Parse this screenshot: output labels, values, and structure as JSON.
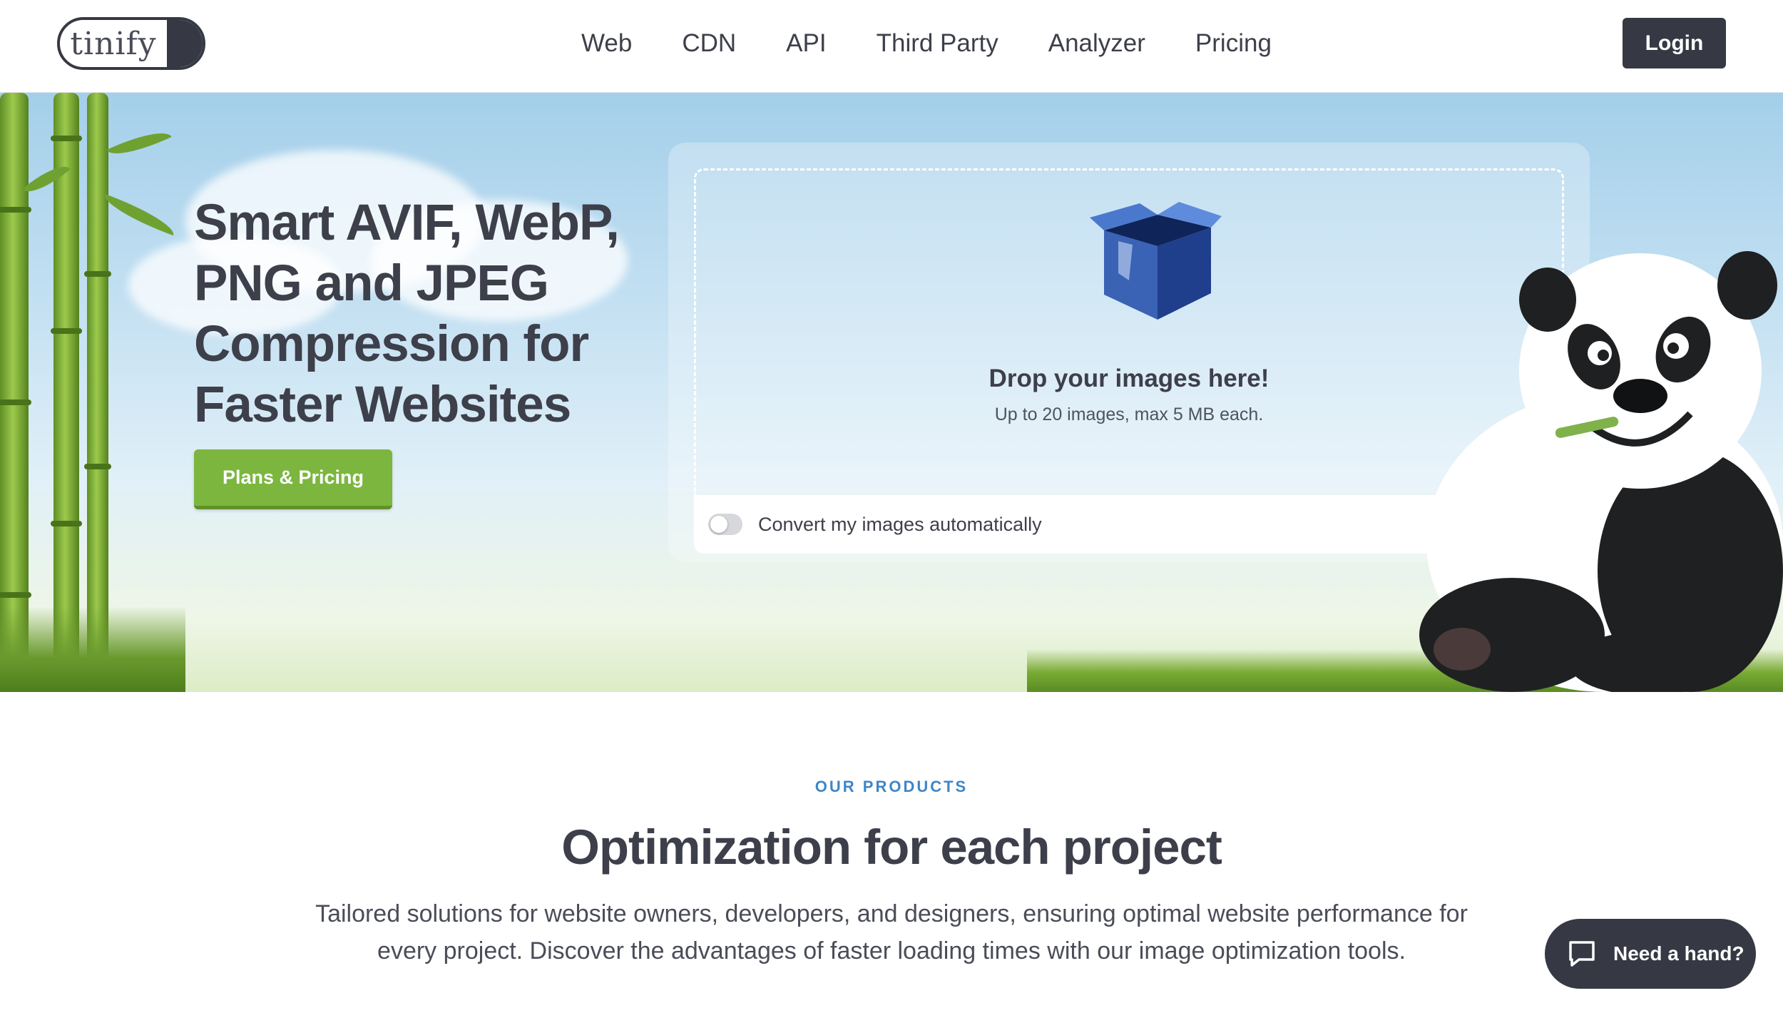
{
  "header": {
    "logo_text": "tinify",
    "nav": [
      "Web",
      "CDN",
      "API",
      "Third Party",
      "Analyzer",
      "Pricing"
    ],
    "login_label": "Login"
  },
  "hero": {
    "title": "Smart AVIF, WebP, PNG and JPEG Compression for Faster Websites",
    "cta_label": "Plans & Pricing"
  },
  "dropzone": {
    "title": "Drop your images here!",
    "subtitle": "Up to 20 images, max 5 MB each.",
    "convert_label": "Convert my images automatically",
    "convert_enabled": false
  },
  "products": {
    "eyebrow": "OUR PRODUCTS",
    "title": "Optimization for each project",
    "description": "Tailored solutions for website owners, developers, and designers, ensuring optimal website performance for every project. Discover the advantages of faster loading times with our image optimization tools."
  },
  "help": {
    "label": "Need a hand?"
  },
  "colors": {
    "dark": "#363944",
    "accent_green": "#7cb63f",
    "accent_blue": "#3e86c8"
  }
}
